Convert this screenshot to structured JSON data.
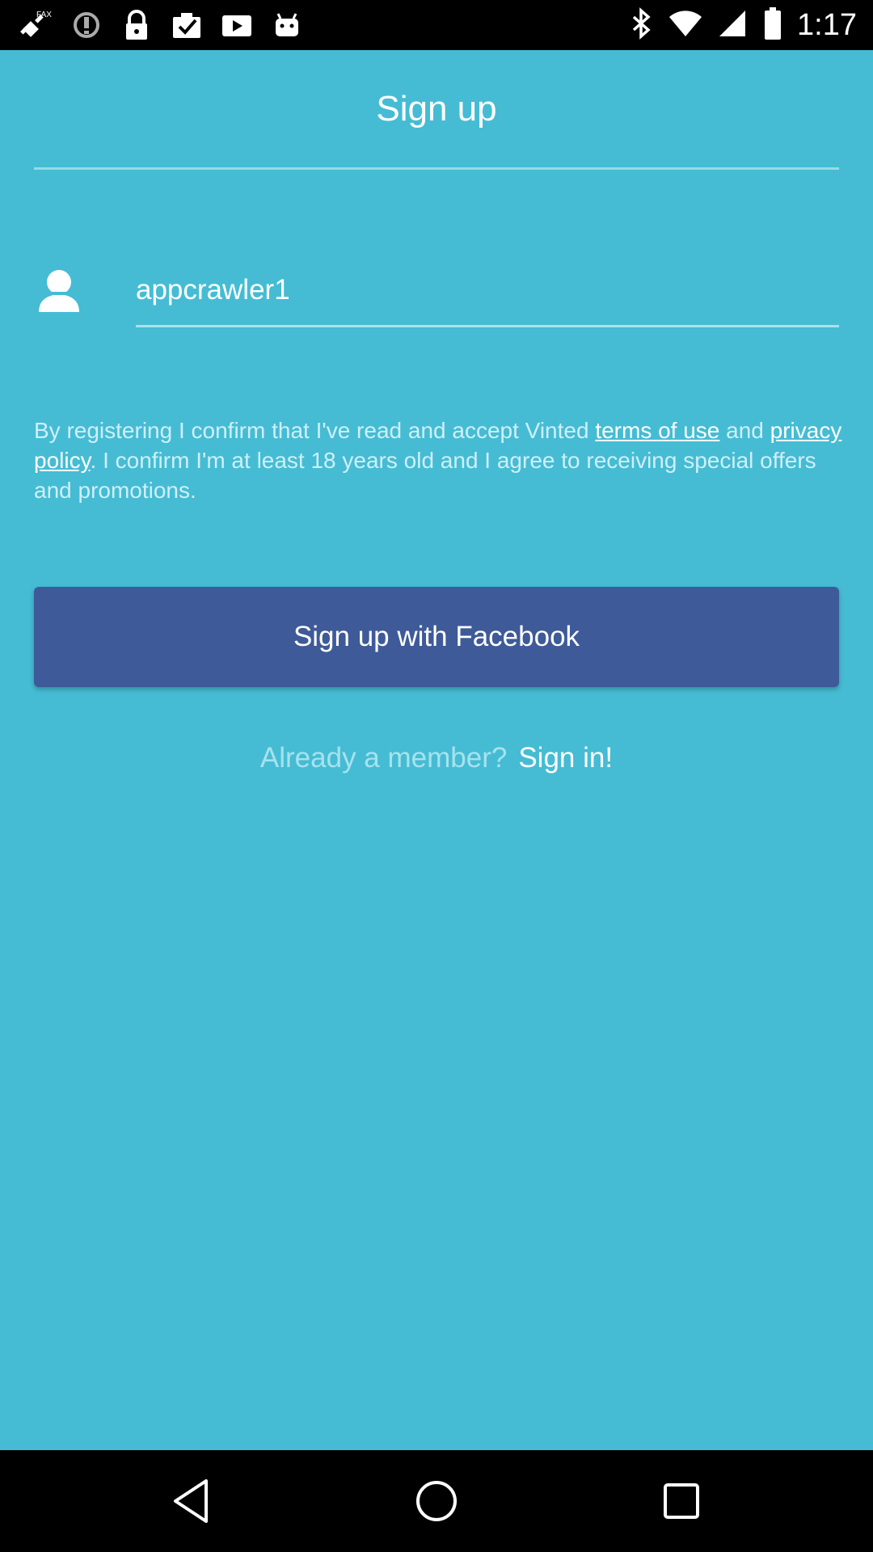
{
  "status_bar": {
    "time": "1:17",
    "left_icons": [
      "fax-satellite-icon",
      "sync-disabled-icon",
      "lock-icon",
      "task-clipboard-icon",
      "play-icon",
      "android-icon"
    ],
    "right_icons": [
      "bluetooth-icon",
      "wifi-icon",
      "signal-icon",
      "battery-icon"
    ]
  },
  "header": {
    "title": "Sign up"
  },
  "form": {
    "username_value": "appcrawler1",
    "terms": {
      "part1": "By registering I confirm that I've read and accept Vinted ",
      "terms_link": "terms of use",
      "part2": " and ",
      "privacy_link": "privacy policy",
      "part3": ". I confirm I'm at least 18 years old and I agree to receiving special offers and promotions."
    },
    "facebook_button_label": "Sign up with Facebook",
    "already_member_text": "Already a member?",
    "sign_in_link": "Sign in!"
  },
  "colors": {
    "background": "#45bcd4",
    "facebook_button": "#3e5a98",
    "text_primary": "#ffffff"
  },
  "nav_bar": {
    "buttons": [
      "back-icon",
      "home-icon",
      "recents-icon"
    ]
  }
}
